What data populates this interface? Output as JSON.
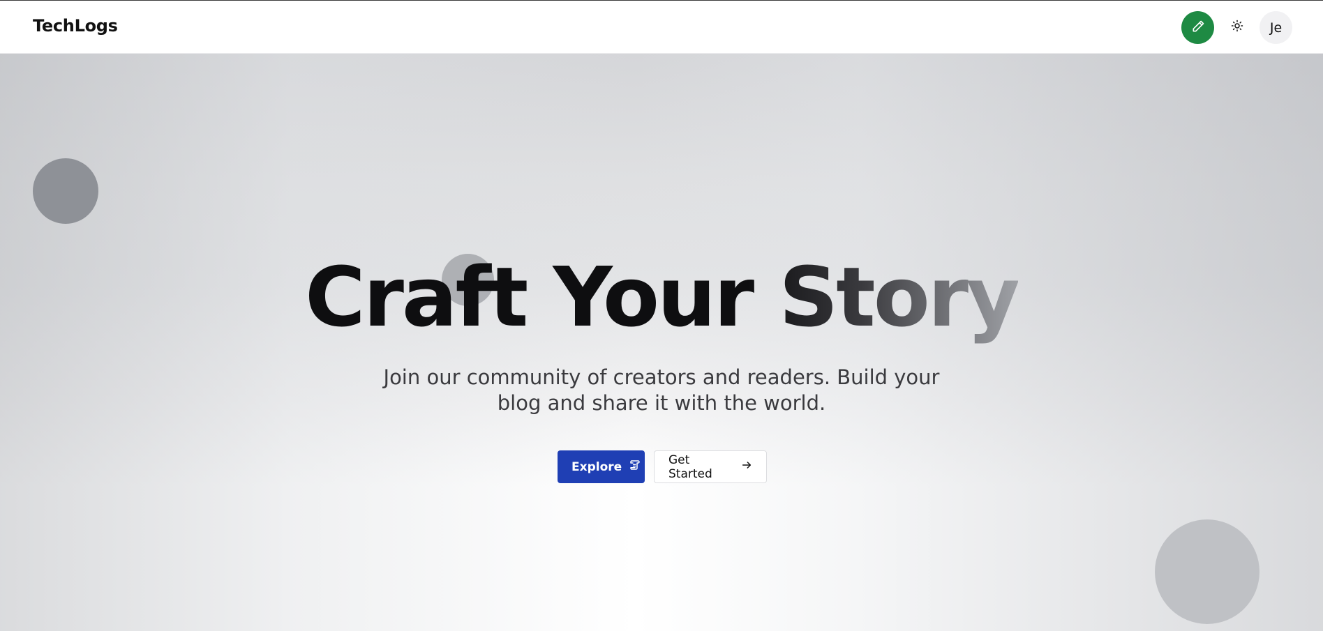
{
  "header": {
    "brand": "TechLogs",
    "write_icon": "pencil-icon",
    "theme_icon": "sun-icon",
    "avatar_initials": "Je"
  },
  "hero": {
    "headline": "Craft Your Story",
    "subtitle": "Join our community of creators and readers. Build your blog and share it with the world.",
    "primary_button": {
      "label": "Explore",
      "icon": "scroll-icon"
    },
    "secondary_button": {
      "label": "Get Started",
      "icon": "arrow-right-icon"
    }
  },
  "colors": {
    "accent_blue": "#1f3fb4",
    "write_green": "#1e8a43",
    "text_dark": "#0e0e10"
  }
}
